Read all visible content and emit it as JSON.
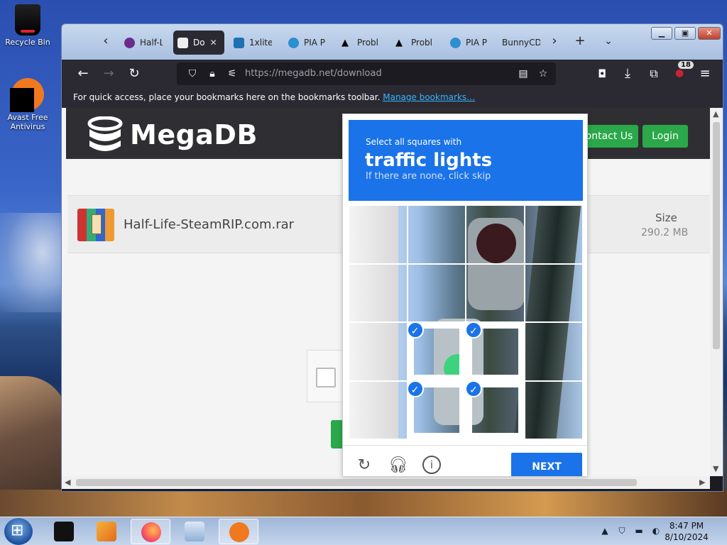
{
  "desktop": {
    "icons": [
      {
        "label": "Recycle Bin"
      },
      {
        "label": "Avast Free Antivirus"
      }
    ]
  },
  "browser": {
    "tabs": [
      {
        "label": "Half-L",
        "icon": "halflife-icon",
        "color": "#6a2c8c"
      },
      {
        "label": "Do",
        "icon": "megadb-icon",
        "color": "#ffffff",
        "active": true
      },
      {
        "label": "1xlite",
        "icon": "1xlite-icon",
        "color": "#1f6fb5"
      },
      {
        "label": "PIA P",
        "icon": "pia-icon",
        "color": "#2c8fd0"
      },
      {
        "label": "Probl",
        "icon": "warning-icon",
        "color": "#000000"
      },
      {
        "label": "Probl",
        "icon": "warning-icon",
        "color": "#000000"
      },
      {
        "label": "PIA P",
        "icon": "pia-icon",
        "color": "#2c8fd0"
      },
      {
        "label": "BunnyCD",
        "icon": "none",
        "color": ""
      }
    ],
    "url": {
      "host": "https://megadb.net",
      "path": "/download"
    },
    "extension_badge": "18",
    "bookmarks_text": "For quick access, place your bookmarks here on the bookmarks toolbar.",
    "bookmarks_link": "Manage bookmarks…"
  },
  "site": {
    "logo": "MegaDB",
    "contact_label": "ontact Us",
    "login_label": "Login",
    "file_name": "Half-Life-SteamRIP.com.rar",
    "size_label": "Size",
    "size_value": "290.2 MB"
  },
  "captcha": {
    "line1": "Select all squares with",
    "line2": "traffic lights",
    "line3": "If there are none, click skip",
    "selected_tiles": [
      9,
      10,
      13,
      14
    ],
    "next_label": "NEXT",
    "accent": "#1a73e8"
  },
  "taskbar": {
    "time": "8:47 PM",
    "date": "8/10/2024"
  }
}
